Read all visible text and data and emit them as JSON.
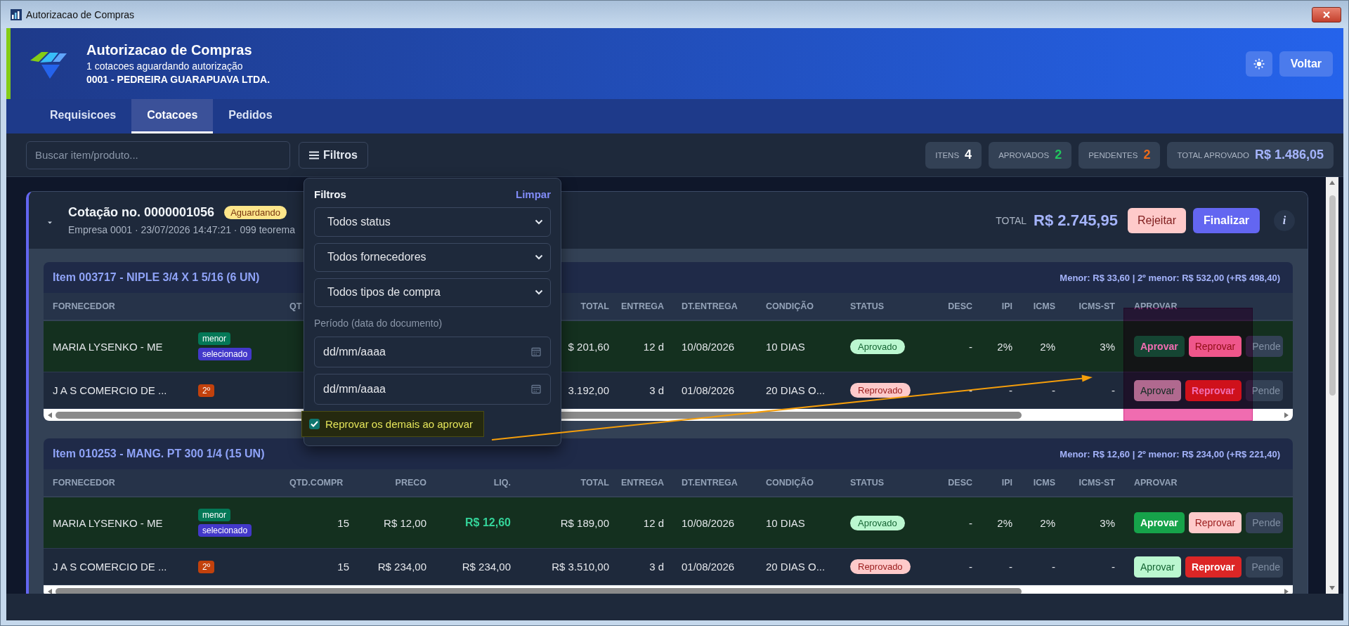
{
  "window": {
    "title": "Autorizacao de Compras"
  },
  "header": {
    "title": "Autorizacao de Compras",
    "subtitle": "1 cotacoes aguardando autorização",
    "company": "0001 - PEDREIRA GUARAPUAVA LTDA.",
    "back_button": "Voltar"
  },
  "tabs": [
    {
      "label": "Requisicoes",
      "selected": false
    },
    {
      "label": "Cotacoes",
      "selected": true
    },
    {
      "label": "Pedidos",
      "selected": false
    }
  ],
  "toolbar": {
    "search": {
      "placeholder": "Buscar item/produto..."
    },
    "filter_button": "Filtros",
    "stats": [
      {
        "label": "ITENS",
        "value": "4",
        "color": "#ffffff"
      },
      {
        "label": "APROVADOS",
        "value": "2",
        "color": "#22c55e"
      },
      {
        "label": "PENDENTES",
        "value": "2",
        "color": "#ea6a1a"
      },
      {
        "label": "TOTAL APROVADO",
        "value": "R$ 1.486,05",
        "color": "#a5b4fc"
      }
    ]
  },
  "quote": {
    "title": "Cotação no. 0000001056",
    "badge": "Aguardando",
    "subtitle": "Empresa 0001 · 23/07/2026 14:47:21 · 099 teorema",
    "total_label": "TOTAL",
    "total": "R$ 2.745,95",
    "reject_button": "Rejeitar",
    "finish_button": "Finalizar",
    "info_button": "i",
    "items": [
      {
        "title": "Item 003717 - NIPLE 3/4 X 1 5/16 (6 UN)",
        "comparison": "Menor: R$ 33,60 | 2º menor: R$ 532,00 (+R$ 498,40)",
        "columns": {
          "supplier": "FORNECEDOR",
          "qty": "QT",
          "total": "TOTAL",
          "delivery": "ENTREGA",
          "delivery_date": "DT.ENTREGA",
          "terms": "CONDIÇÃO",
          "status": "STATUS",
          "discount": "DESC",
          "ipi": "IPI",
          "icms": "ICMS",
          "icms_st": "ICMS-ST",
          "approve": "APROVAR"
        },
        "rows": [
          {
            "selected": true,
            "supplier": "MARIA LYSENKO - ME",
            "tags": [
              {
                "label": "menor",
                "color": "#047857"
              },
              {
                "label": "selecionado",
                "color": "#4338ca"
              }
            ],
            "total": "$ 201,60",
            "delivery": "12 d",
            "delivery_date": "10/08/2026",
            "terms": "10 DIAS",
            "status": {
              "label": "Aprovado",
              "kind": "approved"
            },
            "discount": "-",
            "ipi": "2%",
            "icms": "2%",
            "icms_st": "3%",
            "actions": [
              {
                "label": "Aprovar",
                "kind": "approve",
                "active": true
              },
              {
                "label": "Reprovar",
                "kind": "reject",
                "active": false
              },
              {
                "label": "Pende",
                "kind": "pending",
                "active": false
              }
            ]
          },
          {
            "selected": false,
            "supplier": "J A S COMERCIO DE ...",
            "tags": [
              {
                "label": "2º",
                "color": "#c2410c"
              }
            ],
            "total": "3.192,00",
            "delivery": "3 d",
            "delivery_date": "01/08/2026",
            "terms": "20 DIAS O...",
            "status": {
              "label": "Reprovado",
              "kind": "rejected"
            },
            "discount": "-",
            "ipi": "-",
            "icms": "-",
            "icms_st": "-",
            "actions": [
              {
                "label": "Aprovar",
                "kind": "approve",
                "active": false
              },
              {
                "label": "Reprovar",
                "kind": "reject",
                "active": true
              },
              {
                "label": "Pende",
                "kind": "pending",
                "active": false
              }
            ]
          }
        ]
      },
      {
        "title": "Item 010253 - MANG. PT 300 1/4 (15 UN)",
        "comparison": "Menor: R$ 12,60 | 2º menor: R$ 234,00 (+R$ 221,40)",
        "columns": {
          "supplier": "FORNECEDOR",
          "qty": "QTD.COMPR",
          "price": "PRECO",
          "net": "LIQ.",
          "total": "TOTAL",
          "delivery": "ENTREGA",
          "delivery_date": "DT.ENTREGA",
          "terms": "CONDIÇÃO",
          "status": "STATUS",
          "discount": "DESC",
          "ipi": "IPI",
          "icms": "ICMS",
          "icms_st": "ICMS-ST",
          "approve": "APROVAR"
        },
        "rows": [
          {
            "selected": true,
            "supplier": "MARIA LYSENKO - ME",
            "tags": [
              {
                "label": "menor",
                "color": "#047857"
              },
              {
                "label": "selecionado",
                "color": "#4338ca"
              }
            ],
            "qty": "15",
            "price": "R$ 12,00",
            "net": "R$ 12,60",
            "total": "R$ 189,00",
            "delivery": "12 d",
            "delivery_date": "10/08/2026",
            "terms": "10 DIAS",
            "status": {
              "label": "Aprovado",
              "kind": "approved"
            },
            "discount": "-",
            "ipi": "2%",
            "icms": "2%",
            "icms_st": "3%",
            "actions": [
              {
                "label": "Aprovar",
                "kind": "approve",
                "active": true
              },
              {
                "label": "Reprovar",
                "kind": "reject",
                "active": false
              },
              {
                "label": "Pende",
                "kind": "pending",
                "active": false
              }
            ]
          },
          {
            "selected": false,
            "supplier": "J A S COMERCIO DE ...",
            "tags": [
              {
                "label": "2º",
                "color": "#c2410c"
              }
            ],
            "qty": "15",
            "price": "R$ 234,00",
            "net": "R$ 234,00",
            "total": "R$ 3.510,00",
            "delivery": "3 d",
            "delivery_date": "01/08/2026",
            "terms": "20 DIAS O...",
            "status": {
              "label": "Reprovado",
              "kind": "rejected"
            },
            "discount": "-",
            "ipi": "-",
            "icms": "-",
            "icms_st": "-",
            "actions": [
              {
                "label": "Aprovar",
                "kind": "approve",
                "active": false
              },
              {
                "label": "Reprovar",
                "kind": "reject",
                "active": true
              },
              {
                "label": "Pende",
                "kind": "pending",
                "active": false
              }
            ]
          }
        ]
      }
    ]
  },
  "filters": {
    "title": "Filtros",
    "clear_link": "Limpar",
    "selects": [
      "Todos status",
      "Todos fornecedores",
      "Todos tipos de compra"
    ],
    "period_label": "Período (data do documento)",
    "date_from": {
      "placeholder": "dd/mm/aaaa"
    },
    "date_to": {
      "placeholder": "dd/mm/aaaa"
    },
    "reject_others": {
      "label": "Reprovar os demais ao aprovar",
      "checked": true
    }
  },
  "annotations": {
    "arrow": true,
    "highlight": true
  }
}
